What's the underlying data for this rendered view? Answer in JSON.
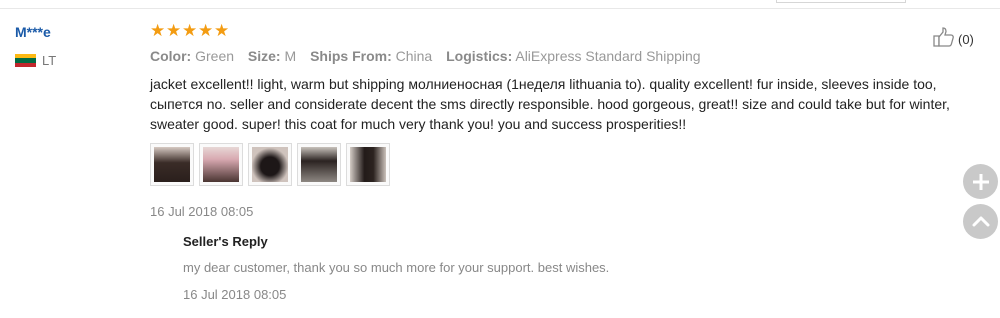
{
  "review": {
    "user": "M***e",
    "country_code": "LT",
    "rating": 5,
    "attributes": [
      {
        "label": "Color:",
        "value": "Green"
      },
      {
        "label": "Size:",
        "value": "M"
      },
      {
        "label": "Ships From:",
        "value": "China"
      },
      {
        "label": "Logistics:",
        "value": "AliExpress Standard Shipping"
      }
    ],
    "text": "jacket excellent!! light, warm but shipping молниеносная (1неделя lithuania to). quality excellent! fur inside, sleeves inside too, сыпется no. seller and considerate decent the sms directly responsible. hood gorgeous, great!! size and could take but for winter, sweater good. super! this coat for much very thank you! you and success prosperities!!",
    "date": "16 Jul 2018 08:05",
    "helpful_count": "(0)"
  },
  "seller_reply": {
    "title": "Seller's Reply",
    "text": "my dear customer, thank you so much more for your support. best wishes.",
    "date": "16 Jul 2018 08:05"
  },
  "icons": {
    "flag": "lithuania-flag-icon",
    "thumbs": "thumbs-up-icon",
    "plus": "plus-icon",
    "up": "chevron-up-icon"
  },
  "colors": {
    "user": "#1a5aa8",
    "star": "#f39c12",
    "flag": [
      "#fdb913",
      "#006a44",
      "#c1272d"
    ]
  }
}
